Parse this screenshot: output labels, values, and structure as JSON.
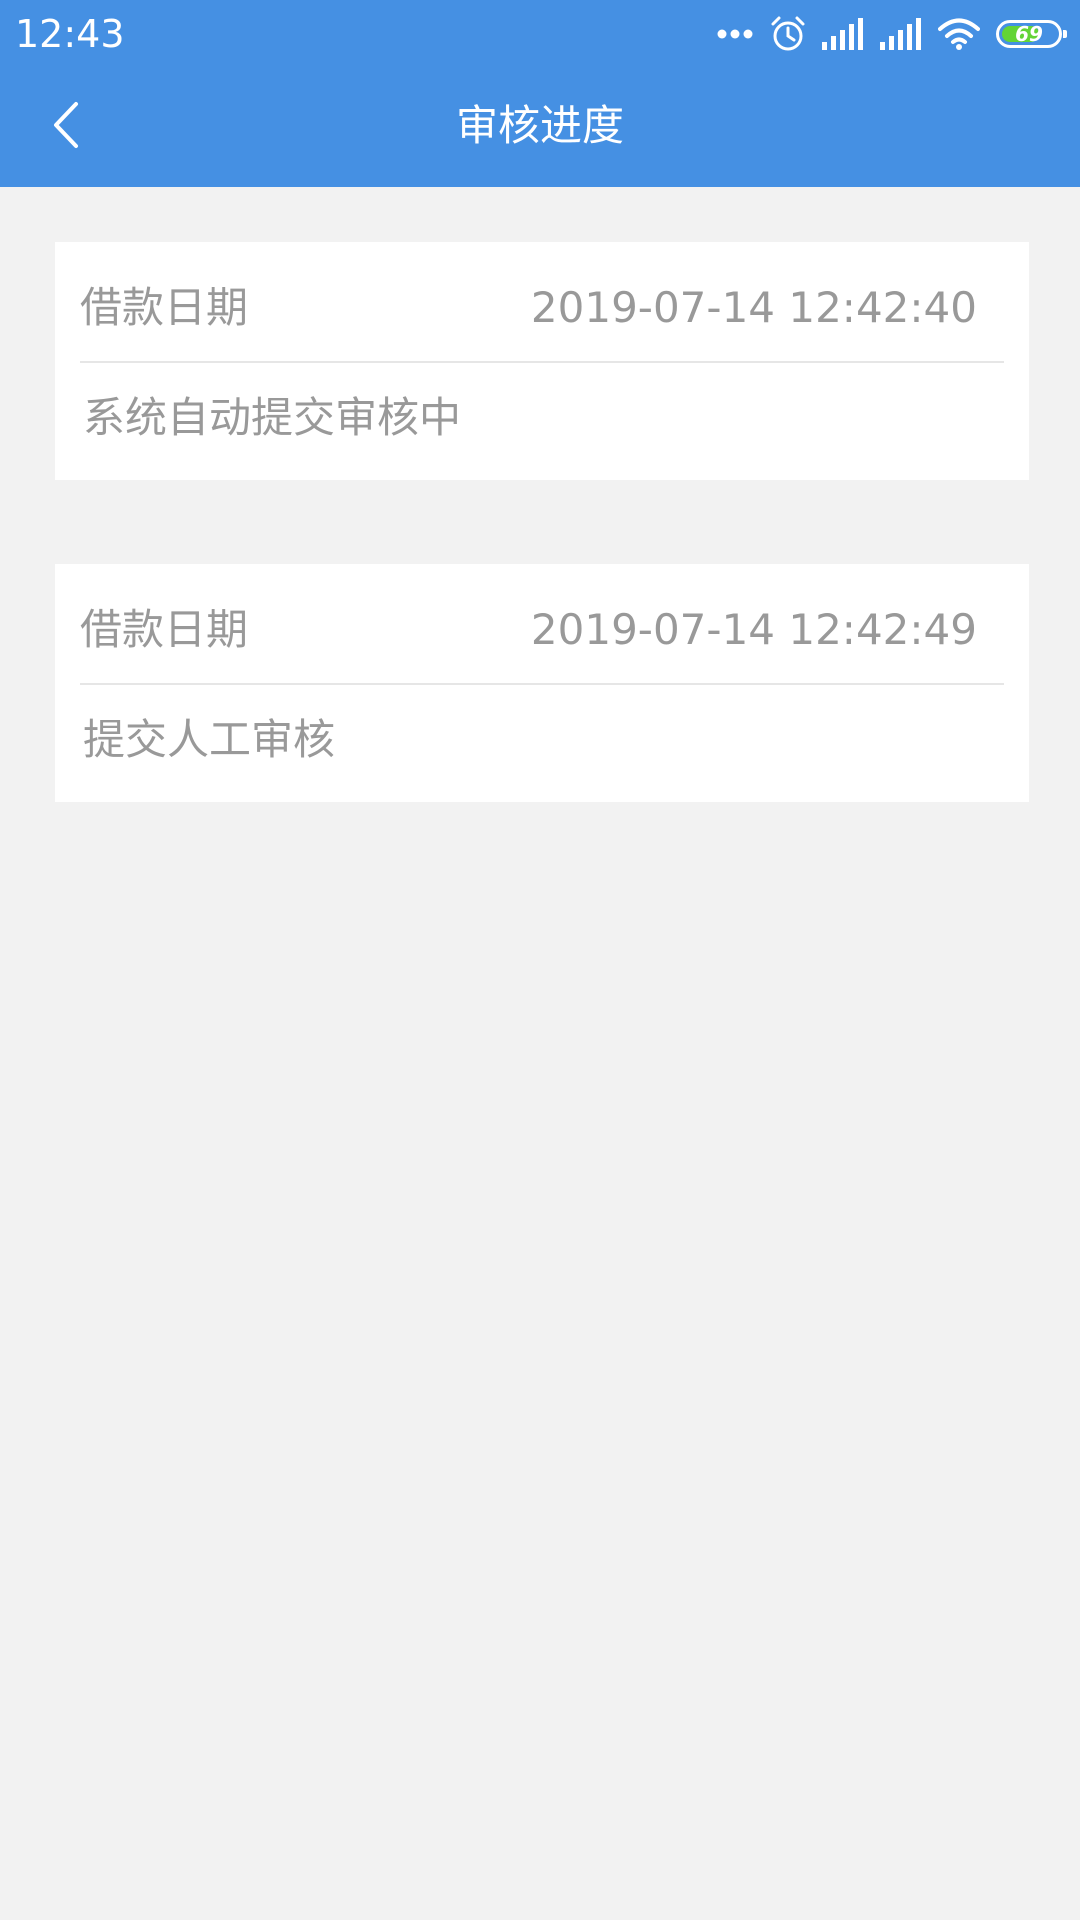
{
  "status_bar": {
    "time": "12:43",
    "icons": [
      "more-dots-icon",
      "alarm-icon",
      "signal-icon",
      "signal-icon",
      "wifi-icon",
      "battery-icon"
    ],
    "battery_level": "69",
    "battery_fill_fraction": 0.69,
    "battery_fill_color": "#63d436"
  },
  "nav": {
    "title": "审核进度",
    "back_icon": "chevron-left-icon",
    "background_color": "#4590e3"
  },
  "records": [
    {
      "label": "借款日期",
      "datetime": "2019-07-14 12:42:40",
      "status": "系统自动提交审核中"
    },
    {
      "label": "借款日期",
      "datetime": "2019-07-14 12:42:49",
      "status": "提交人工审核"
    }
  ]
}
